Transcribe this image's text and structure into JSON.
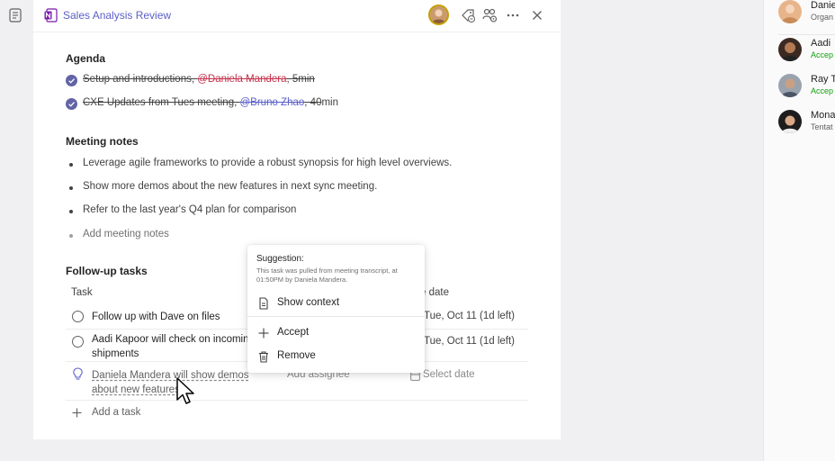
{
  "header": {
    "title": "Sales Analysis Review"
  },
  "agenda": {
    "title": "Agenda",
    "items": [
      {
        "text_before": "Setup and introductions, ",
        "mention": "@Daniela Mandera",
        "text_after": ", 5min"
      },
      {
        "text_before": "CXE Updates from Tues meeting, ",
        "mention": "@Bruno Zhao",
        "text_after_strike": ", 40",
        "text_after": "min"
      }
    ]
  },
  "notes": {
    "title": "Meeting notes",
    "items": [
      "Leverage agile frameworks to provide a robust synopsis for high level overviews.",
      "Show more demos about the new features in next sync meeting.",
      "Refer to the last year's Q4 plan for comparison"
    ],
    "add_placeholder": "Add meeting notes"
  },
  "tasks": {
    "title": "Follow-up tasks",
    "col_task": "Task",
    "col_due_partial": "e date",
    "rows": [
      {
        "text": "Follow up with Dave on files",
        "due": "Tue, Oct 11 (1d left)"
      },
      {
        "text_line1": "Aadi Kapoor will check on incomin",
        "text_line2": "shipments",
        "due": "Tue, Oct 11 (1d left)"
      }
    ],
    "suggested": {
      "line1": "Daniela Mandera will show demos",
      "line2": "about new features",
      "assignee_placeholder": "Add assignee",
      "date_placeholder": "Select date"
    },
    "add_task": "Add a task"
  },
  "suggestion_popup": {
    "title": "Suggestion:",
    "description": "This task was pulled from meeting transcript, at 01:50PM by Daniela Mandera.",
    "show_context": "Show context",
    "accept": "Accept",
    "remove": "Remove"
  },
  "attendees": [
    {
      "name": "Danie",
      "status": "Organ",
      "status_color": "#616161"
    },
    {
      "name": "Aadi",
      "status": "Accep",
      "status_color": "#13a10e"
    },
    {
      "name": "Ray T",
      "status": "Accep",
      "status_color": "#13a10e"
    },
    {
      "name": "Mona",
      "status": "Tentat",
      "status_color": "#616161"
    }
  ],
  "colors": {
    "accent": "#5b5fc7",
    "mention_red": "#c4314b",
    "accepted_green": "#13a10e"
  }
}
